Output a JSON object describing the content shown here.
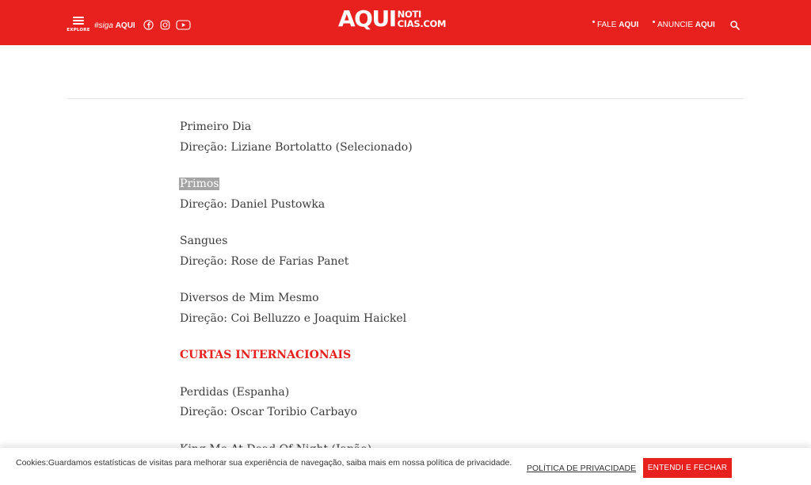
{
  "header": {
    "menu_label": "EXPLORE",
    "siga_prefix": "#siga",
    "siga_suffix": "AQUI",
    "social": [
      "facebook-icon",
      "instagram-icon",
      "youtube-icon"
    ],
    "logo_big": "AQUI",
    "logo_line1": "NOTI",
    "logo_line2": "CIAS.COM",
    "fale_pre": "FALE",
    "fale_post": "AQUI",
    "anuncie_pre": "ANUNCIE",
    "anuncie_post": "AQUI",
    "search_icon": "search-icon",
    "bg_color": "#e8201e"
  },
  "article": {
    "lines": [
      {
        "text": "Primeiro Dia"
      },
      {
        "text": "Direção: Liziane Bortolatto (Selecionado)"
      },
      {
        "text": "Primos"
      },
      {
        "text": "Direção: Daniel Pustowka"
      },
      {
        "text": "Sangues"
      },
      {
        "text": "Direção: Rose de Farias Panet"
      },
      {
        "text": "Diversos de Mim Mesmo"
      },
      {
        "text": "Direção: Coi Belluzzo e Joaquim Haickel"
      },
      {
        "text": "CURTAS INTERNACIONAIS"
      },
      {
        "text": "Perdidas (Espanha)"
      },
      {
        "text": "Direção: Oscar Toribio Carbayo"
      },
      {
        "text": "King Me At Dead Of Night (Japão)"
      }
    ],
    "section_color": "#e8201e",
    "highlight_color": "#a5a5a5"
  },
  "cookie": {
    "text": "Cookies:Guardamos estatísticas de visitas para melhorar sua experiência de navegação, saiba mais em nossa política de privacidade.",
    "policy_label": "POLÍTICA DE PRIVACIDADE",
    "accept_label": "ENTENDI E FECHAR"
  }
}
